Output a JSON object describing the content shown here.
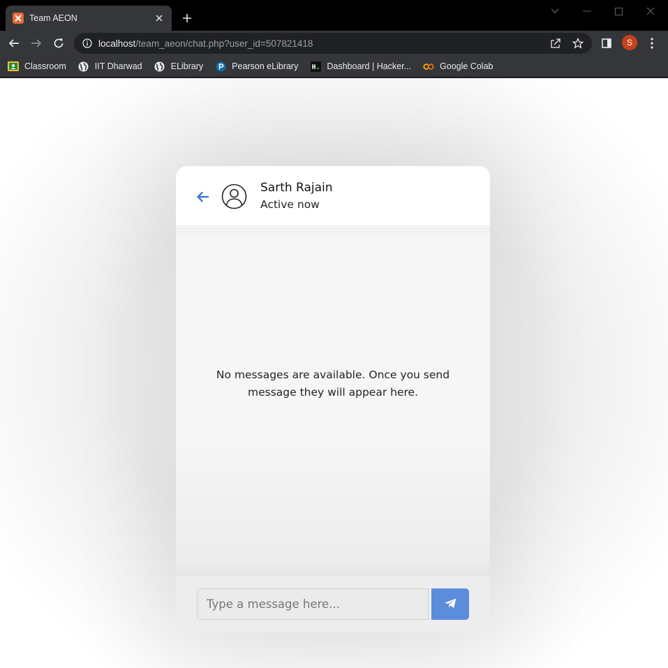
{
  "browser": {
    "tab": {
      "title": "Team AEON",
      "favicon": "xampp-icon"
    },
    "url": {
      "host": "localhost",
      "path": "/team_aeon/chat.php?user_id=507821418"
    },
    "profile_initial": "S",
    "bookmarks": [
      {
        "label": "Classroom",
        "icon": "classroom-icon"
      },
      {
        "label": "IIT Dharwad",
        "icon": "globe-icon"
      },
      {
        "label": "ELibrary",
        "icon": "globe-icon"
      },
      {
        "label": "Pearson eLibrary",
        "icon": "pearson-icon"
      },
      {
        "label": "Dashboard | Hacker...",
        "icon": "hackerrank-icon"
      },
      {
        "label": "Google Colab",
        "icon": "colab-icon"
      }
    ]
  },
  "chat": {
    "user_name": "Sarth Rajain",
    "status": "Active now",
    "empty_message": "No messages are available. Once you send message they will appear here.",
    "input_placeholder": "Type a message here..."
  },
  "colors": {
    "accent": "#5b8ddc",
    "back_arrow": "#3f7ad8",
    "tab_bar": "#000000",
    "toolbar": "#35363a",
    "profile": "#c5421c"
  }
}
